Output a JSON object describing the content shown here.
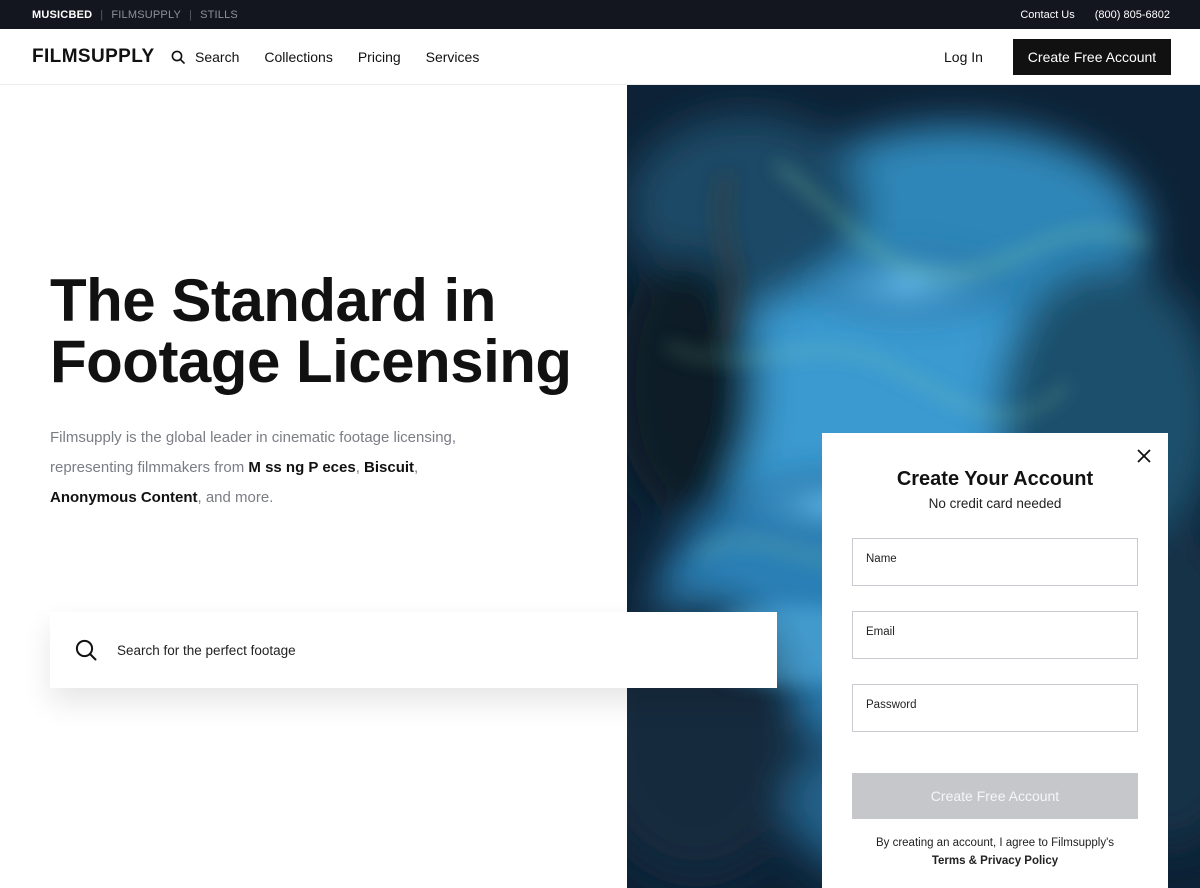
{
  "topbar": {
    "brands": [
      "MUSICBED",
      "FILMSUPPLY",
      "STILLS"
    ],
    "separator": "|",
    "contact": "Contact Us",
    "phone": "(800) 805-6802"
  },
  "nav": {
    "logo": "FILMSUPPLY",
    "search_label": "Search",
    "collections_label": "Collections",
    "pricing_label": "Pricing",
    "services_label": "Services",
    "login_label": "Log In",
    "cta_label": "Create Free Account"
  },
  "hero": {
    "headline_line1": "The Standard in",
    "headline_line2": "Footage Licensing",
    "desc_part1": "Filmsupply is the global leader in cinematic footage licensing, representing filmmakers from ",
    "desc_brand1": "M ss ng P eces",
    "desc_comma1": ",",
    "desc_brand2": "Biscuit",
    "desc_comma2": ", ",
    "desc_brand3": "Anonymous Content",
    "desc_part2": ", and more.",
    "search_placeholder": "Search for the perfect footage"
  },
  "modal": {
    "title": "Create Your Account",
    "subtitle": "No credit card needed",
    "name_label": "Name",
    "email_label": "Email",
    "password_label": "Password",
    "submit_label": "Create Free Account",
    "legal_text": "By creating an account, I agree to Filmsupply's",
    "terms_label": "Terms & Privacy Policy"
  },
  "colors": {
    "topbar_bg": "#14161f",
    "primary_button": "#111111",
    "disabled_button": "#c6c7ca",
    "muted_text": "#7b7d84"
  },
  "icons": [
    "search-icon",
    "close-icon"
  ]
}
